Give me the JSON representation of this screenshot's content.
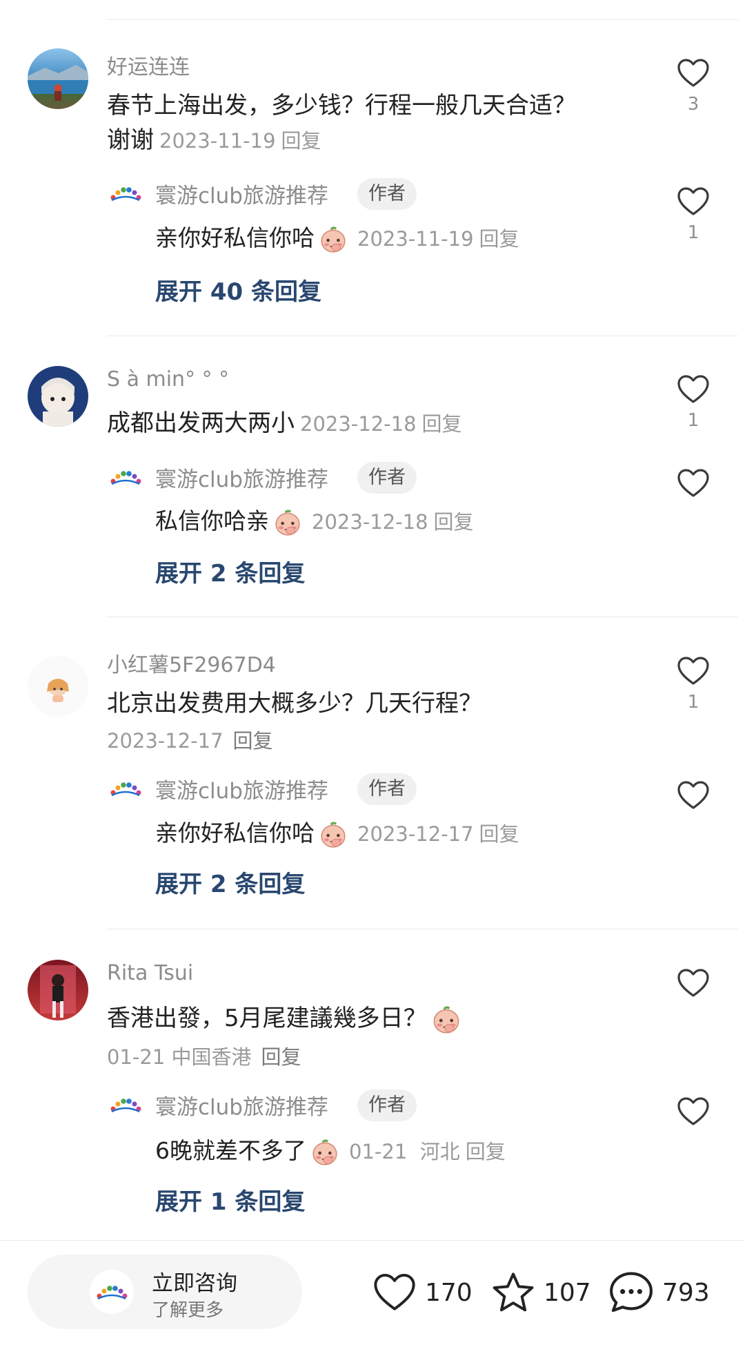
{
  "comments": [
    {
      "username": "好运连连",
      "text": "春节上海出发，多少钱？行程一般几天合适？谢谢",
      "date": "2023-11-19",
      "reply_label": "回复",
      "likes": "3",
      "author_reply": {
        "name": "寰游club旅游推荐",
        "badge": "作者",
        "text": "亲你好私信你哈",
        "date": "2023-11-19",
        "reply_label": "回复",
        "likes": "1"
      },
      "expand_label": "展开 40 条回复"
    },
    {
      "username": "S à min°  °  °",
      "text": "成都出发两大两小",
      "date": "2023-12-18",
      "reply_label": "回复",
      "likes": "1",
      "author_reply": {
        "name": "寰游club旅游推荐",
        "badge": "作者",
        "text": "私信你哈亲",
        "date": "2023-12-18",
        "reply_label": "回复",
        "likes": ""
      },
      "expand_label": "展开 2 条回复"
    },
    {
      "username": "小红薯5F2967D4",
      "text": "北京出发费用大概多少？几天行程？",
      "date": "2023-12-17",
      "reply_label": "回复",
      "likes": "1",
      "author_reply": {
        "name": "寰游club旅游推荐",
        "badge": "作者",
        "text": "亲你好私信你哈",
        "date": "2023-12-17",
        "reply_label": "回复",
        "likes": ""
      },
      "expand_label": "展开 2 条回复"
    },
    {
      "username": "Rita Tsui",
      "text": "香港出發，5月尾建議幾多日？",
      "date": "01-21",
      "location": "中国香港",
      "reply_label": "回复",
      "likes": "",
      "author_reply": {
        "name": "寰游club旅游推荐",
        "badge": "作者",
        "text": "6晚就差不多了",
        "date": "01-21",
        "location": "河北",
        "reply_label": "回复",
        "likes": ""
      },
      "expand_label": "展开 1 条回复"
    }
  ],
  "bottom_bar": {
    "consult_title": "立即咨询",
    "consult_subtitle": "了解更多",
    "like_count": "170",
    "collect_count": "107",
    "comment_count": "793"
  },
  "colors": {
    "expand_link": "#29476f",
    "meta_gray": "#9a9a9a"
  },
  "icons": [
    "heart-icon",
    "star-icon",
    "chat-bubble-icon",
    "shy-face-emoji",
    "rainbow-logo"
  ]
}
